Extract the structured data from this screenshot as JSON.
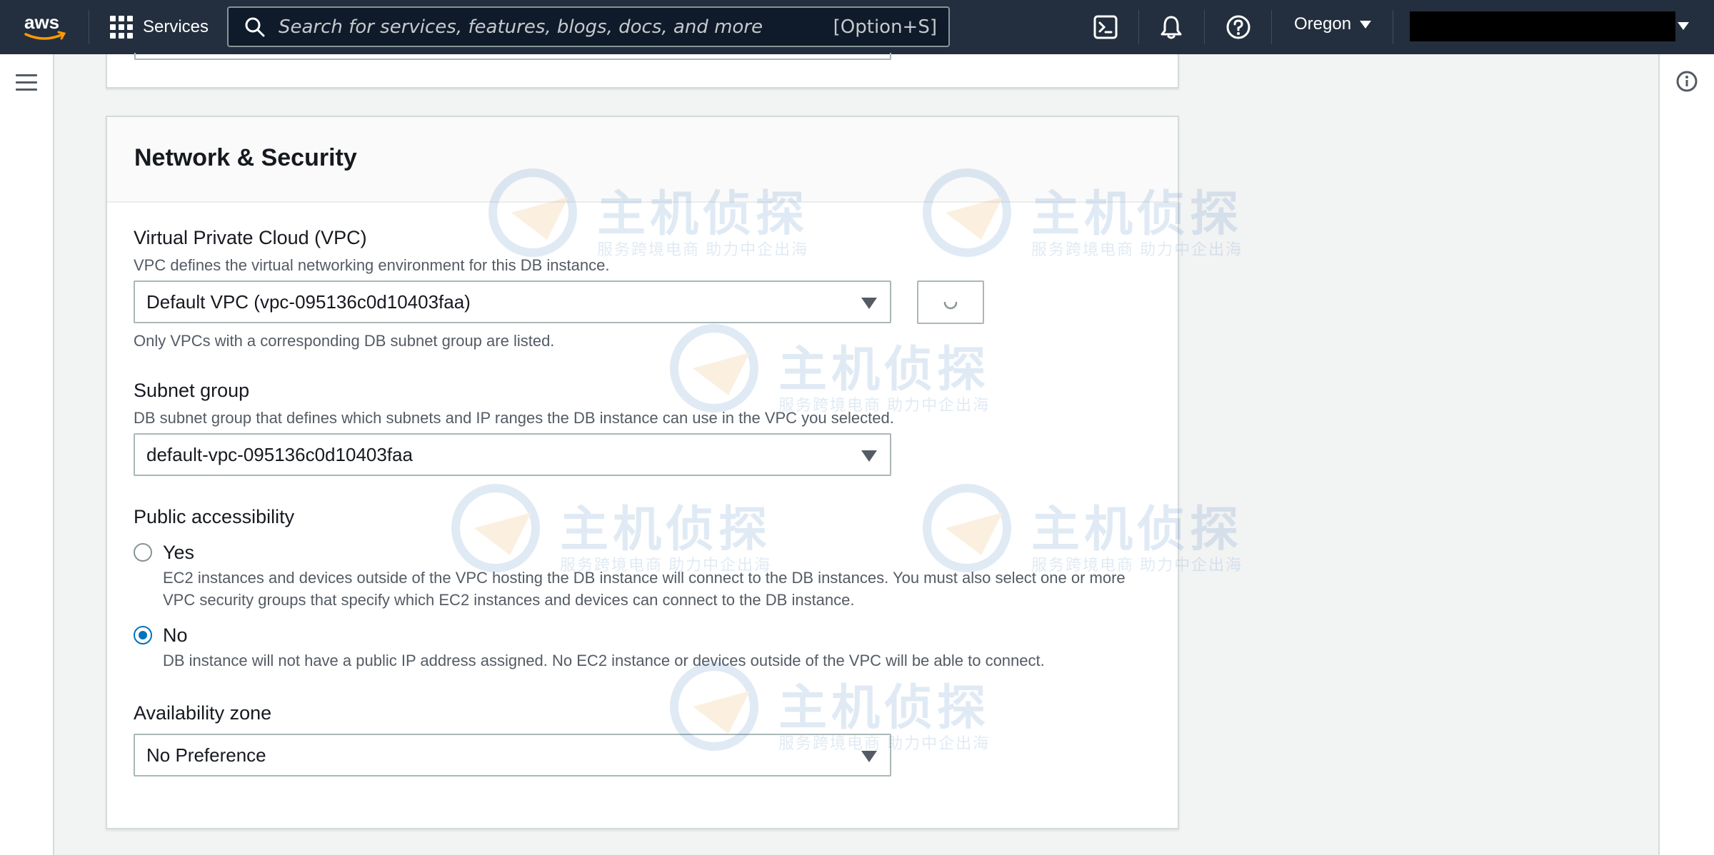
{
  "topnav": {
    "services_label": "Services",
    "search_placeholder": "Search for services, features, blogs, docs, and more",
    "search_shortcut": "[Option+S]",
    "region": "Oregon"
  },
  "section": {
    "title": "Network & Security",
    "vpc": {
      "label": "Virtual Private Cloud (VPC)",
      "description": "VPC defines the virtual networking environment for this DB instance.",
      "value": "Default VPC (vpc-095136c0d10403faa)",
      "hint": "Only VPCs with a corresponding DB subnet group are listed."
    },
    "subnet": {
      "label": "Subnet group",
      "description": "DB subnet group that defines which subnets and IP ranges the DB instance can use in the VPC you selected.",
      "value": "default-vpc-095136c0d10403faa"
    },
    "public_access": {
      "label": "Public accessibility",
      "options": [
        {
          "label": "Yes",
          "description": "EC2 instances and devices outside of the VPC hosting the DB instance will connect to the DB instances. You must also select one or more VPC security groups that specify which EC2 instances and devices can connect to the DB instance.",
          "selected": false
        },
        {
          "label": "No",
          "description": "DB instance will not have a public IP address assigned. No EC2 instance or devices outside of the VPC will be able to connect.",
          "selected": true
        }
      ]
    },
    "availability_zone": {
      "label": "Availability zone",
      "value": "No Preference"
    }
  },
  "watermark": {
    "title": "主机侦探",
    "subtitle": "服务跨境电商 助力中企出海"
  },
  "colors": {
    "nav_bg": "#232f3e",
    "accent": "#0073bb",
    "page_bg": "#f2f3f3"
  }
}
